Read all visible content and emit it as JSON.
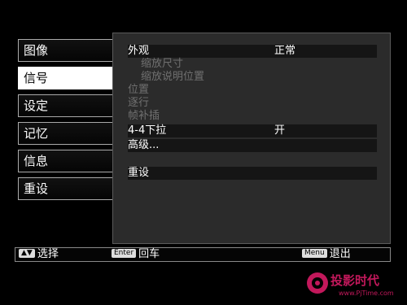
{
  "sidebar": {
    "items": [
      {
        "label": "图像"
      },
      {
        "label": "信号",
        "active": true
      },
      {
        "label": "设定"
      },
      {
        "label": "记忆"
      },
      {
        "label": "信息"
      },
      {
        "label": "重设"
      }
    ]
  },
  "panel": {
    "rows": [
      {
        "label": "外观",
        "value": "正常"
      },
      {
        "label": "缩放尺寸",
        "value": ""
      },
      {
        "label": "缩放说明位置",
        "value": ""
      },
      {
        "label": "位置",
        "value": ""
      },
      {
        "label": "逐行",
        "value": ""
      },
      {
        "label": "帧补插",
        "value": ""
      },
      {
        "label": "4-4下拉",
        "value": "开"
      },
      {
        "label": "高级...",
        "value": ""
      },
      {
        "label": "重设",
        "value": ""
      }
    ]
  },
  "footer": {
    "select_label": "选择",
    "enter_key": "Enter",
    "enter_label": "回车",
    "menu_key": "Menu",
    "menu_label": "退出"
  },
  "watermark": {
    "name": "投影时代",
    "url": "www.PjTime.com"
  },
  "colors": {
    "panel_bg": "#2b2b2b",
    "active_bg": "#ffffff",
    "watermark": "#c2185b"
  },
  "icons": {
    "active_indicator": "enter-arrow-icon",
    "select_key": "up-down-arrow-icon"
  }
}
